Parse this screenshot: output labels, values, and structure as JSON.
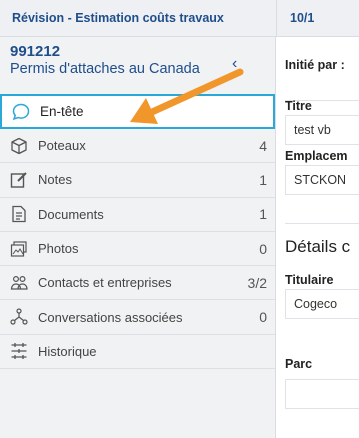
{
  "header": {
    "title": "Révision - Estimation coûts travaux",
    "date": "10/1"
  },
  "record": {
    "number": "991212",
    "name": "Permis d'attaches au Canada",
    "collapse_glyph": "‹"
  },
  "nav": {
    "items": [
      {
        "label": "En-tête",
        "count": "",
        "icon": "speech-bubble-icon",
        "active": true
      },
      {
        "label": "Poteaux",
        "count": "4",
        "icon": "cube-icon"
      },
      {
        "label": "Notes",
        "count": "1",
        "icon": "edit-note-icon"
      },
      {
        "label": "Documents",
        "count": "1",
        "icon": "document-icon"
      },
      {
        "label": "Photos",
        "count": "0",
        "icon": "photo-icon"
      },
      {
        "label": "Contacts et entreprises",
        "count": "3/2",
        "icon": "contacts-icon"
      },
      {
        "label": "Conversations associées",
        "count": "0",
        "icon": "network-icon"
      },
      {
        "label": "Historique",
        "count": "",
        "icon": "history-icon"
      }
    ]
  },
  "main": {
    "initiated_label": "Initié par :",
    "title_label": "Titre",
    "title_value": "test vb",
    "location_label": "Emplacem",
    "location_value": "STCKON",
    "details_heading": "Détails c",
    "holder_label": "Titulaire",
    "holder_value": "Cogeco",
    "park_label": "Parc"
  },
  "colors": {
    "brand_blue": "#1f4e8c",
    "active_border": "#2aa8d8",
    "annotation_arrow": "#f0962a"
  }
}
